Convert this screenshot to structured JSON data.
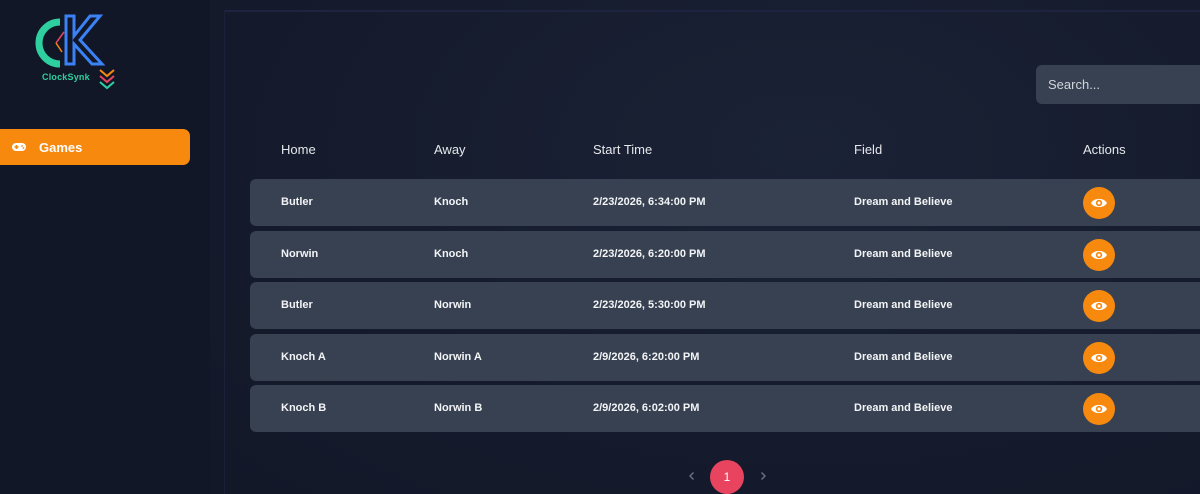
{
  "brand": {
    "name": "ClockSynk",
    "colors": {
      "primary": "#2fd0a0",
      "secondary": "#3b82f6",
      "accent": "#f7890f"
    }
  },
  "sidebar": {
    "items": [
      {
        "label": "Games",
        "icon": "gamepad-icon",
        "active": true
      }
    ]
  },
  "search": {
    "placeholder": "Search..."
  },
  "table": {
    "headers": {
      "home": "Home",
      "away": "Away",
      "start_time": "Start Time",
      "field": "Field",
      "actions": "Actions"
    },
    "rows": [
      {
        "home": "Butler",
        "away": "Knoch",
        "start_time": "2/23/2026, 6:34:00 PM",
        "field": "Dream and Believe"
      },
      {
        "home": "Norwin",
        "away": "Knoch",
        "start_time": "2/23/2026, 6:20:00 PM",
        "field": "Dream and Believe"
      },
      {
        "home": "Butler",
        "away": "Norwin",
        "start_time": "2/23/2026, 5:30:00 PM",
        "field": "Dream and Believe"
      },
      {
        "home": "Knoch A",
        "away": "Norwin A",
        "start_time": "2/9/2026, 6:20:00 PM",
        "field": "Dream and Believe"
      },
      {
        "home": "Knoch B",
        "away": "Norwin B",
        "start_time": "2/9/2026, 6:02:00 PM",
        "field": "Dream and Believe"
      }
    ],
    "row_action_icon": "eye-icon"
  },
  "pagination": {
    "current": "1",
    "prev_icon": "chevron-left-icon",
    "next_icon": "chevron-right-icon"
  }
}
